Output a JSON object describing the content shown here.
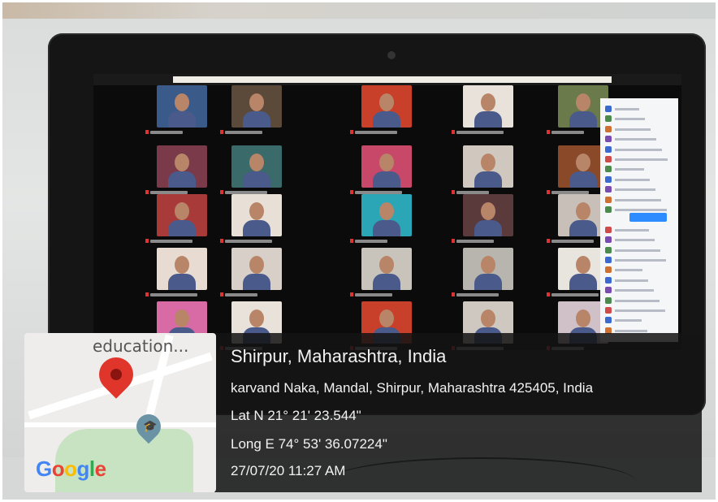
{
  "overlay": {
    "location_title": "Shirpur, Maharashtra, India",
    "address": "karvand Naka, Mandal, Shirpur, Maharashtra 425405, India",
    "latitude": "Lat N 21° 21' 23.544\"",
    "longitude": "Long E 74° 53' 36.07224\"",
    "datetime": "27/07/20 11:27 AM"
  },
  "map": {
    "place_label": "education...",
    "logo_letters": [
      "G",
      "o",
      "o",
      "g",
      "l",
      "e"
    ],
    "logo_colors": [
      "#4285f4",
      "#ea4335",
      "#fbbc05",
      "#4285f4",
      "#34a853",
      "#ea4335"
    ],
    "pin_icon": "location-pin-icon",
    "school_icon": "school-pin-icon"
  },
  "colors": {
    "overlay_text": "#f2f2f2",
    "zoom_accent": "#2d8cff"
  }
}
